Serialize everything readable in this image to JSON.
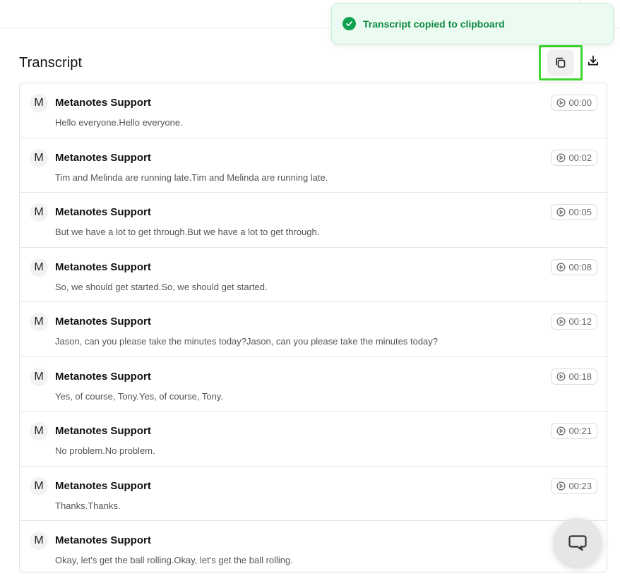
{
  "toast": {
    "message": "Transcript copied to clipboard",
    "icon": "check-circle-icon",
    "color": "#12a150"
  },
  "header": {
    "title": "Transcript",
    "copy_icon": "copy-icon",
    "download_icon": "download-icon",
    "highlight_color": "#3dd62e"
  },
  "transcript": [
    {
      "initial": "M",
      "speaker": "Metanotes Support",
      "text": "Hello everyone.Hello everyone.",
      "time": "00:00"
    },
    {
      "initial": "M",
      "speaker": "Metanotes Support",
      "text": "Tim and Melinda are running late.Tim and Melinda are running late.",
      "time": "00:02"
    },
    {
      "initial": "M",
      "speaker": "Metanotes Support",
      "text": "But we have a lot to get through.But we have a lot to get through.",
      "time": "00:05"
    },
    {
      "initial": "M",
      "speaker": "Metanotes Support",
      "text": "So, we should get started.So, we should get started.",
      "time": "00:08"
    },
    {
      "initial": "M",
      "speaker": "Metanotes Support",
      "text": "Jason, can you please take the minutes today?Jason, can you please take the minutes today?",
      "time": "00:12"
    },
    {
      "initial": "M",
      "speaker": "Metanotes Support",
      "text": "Yes, of course, Tony.Yes, of course, Tony.",
      "time": "00:18"
    },
    {
      "initial": "M",
      "speaker": "Metanotes Support",
      "text": "No problem.No problem.",
      "time": "00:21"
    },
    {
      "initial": "M",
      "speaker": "Metanotes Support",
      "text": "Thanks.Thanks.",
      "time": "00:23"
    },
    {
      "initial": "M",
      "speaker": "Metanotes Support",
      "text": "Okay, let's get the ball rolling.Okay, let's get the ball rolling.",
      "time": ""
    }
  ],
  "chat": {
    "icon": "chat-bubble-icon"
  }
}
